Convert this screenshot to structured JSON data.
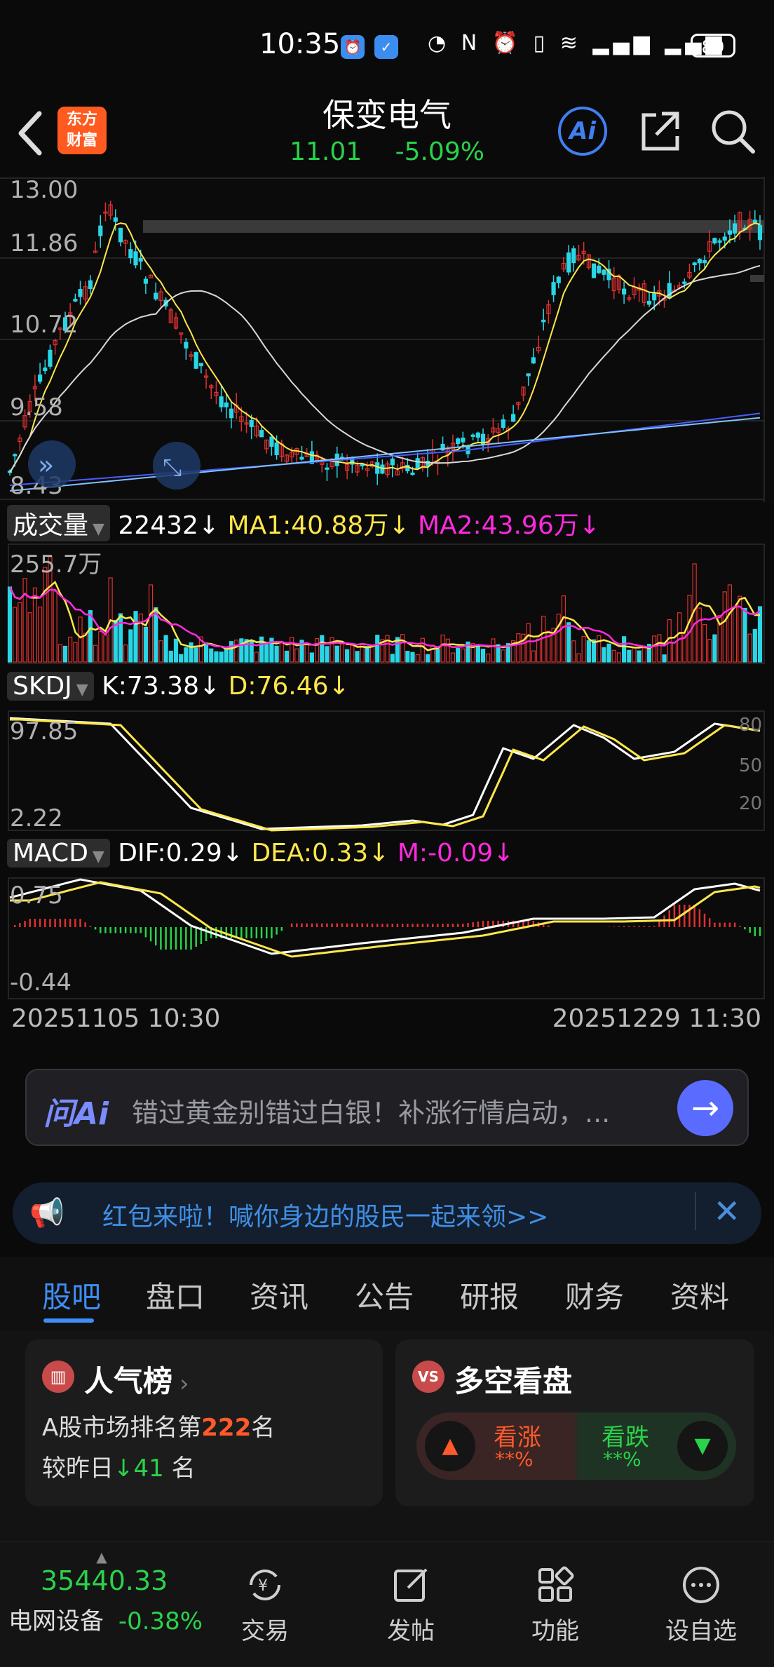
{
  "status_bar": {
    "time": "10:35",
    "battery": "89",
    "icons": [
      "app-icon-1",
      "app-icon-2",
      "speed-icon",
      "nfc-icon",
      "alarm-icon",
      "vibrate-icon",
      "wifi-icon",
      "4g-signal-icon",
      "4g-signal-icon"
    ]
  },
  "header": {
    "back_icon": "chevron-left-icon",
    "logo_text": "东方财富",
    "stock_name": "保变电气",
    "price": "11.01",
    "change_pct": "-5.09%",
    "ai_label": "Ai",
    "share_icon": "share-icon",
    "search_icon": "search-icon"
  },
  "price_chart": {
    "y_labels": [
      "13.00",
      "11.86",
      "10.72",
      "9.58",
      "8.43"
    ]
  },
  "volume_indicator": {
    "selector": "成交量",
    "value": "22432↓",
    "ma1": "MA1:40.88万↓",
    "ma2": "MA2:43.96万↓",
    "y_max": "255.7万"
  },
  "skdj_indicator": {
    "selector": "SKDJ",
    "k": "K:73.38↓",
    "d": "D:76.46↓",
    "y_max": "97.85",
    "y_min": "2.22",
    "ref_levels": [
      "80",
      "50",
      "20"
    ]
  },
  "macd_indicator": {
    "selector": "MACD",
    "dif": "DIF:0.29↓",
    "dea": "DEA:0.33↓",
    "m": "M:-0.09↓",
    "y_max": "0.75",
    "y_min": "-0.44"
  },
  "date_range": {
    "start": "20251105 10:30",
    "end": "20251229 11:30"
  },
  "ask_ai": {
    "logo": "问Ai",
    "text": "错过黄金别错过白银！补涨行情启动，...",
    "send_icon": "arrow-right-icon"
  },
  "banner": {
    "icon": "megaphone-icon",
    "text": "红包来啦！喊你身边的股民一起来领>>",
    "close_icon": "close-icon"
  },
  "tabs": [
    "股吧",
    "盘口",
    "资讯",
    "公告",
    "研报",
    "财务",
    "资料"
  ],
  "active_tab": 0,
  "popularity_card": {
    "title": "人气榜",
    "rank_prefix": "A股市场排名第",
    "rank": "222",
    "rank_suffix": "名",
    "change_prefix": "较昨日",
    "change": "41",
    "change_suffix": "名"
  },
  "sentiment_card": {
    "icon_text": "VS",
    "title": "多空看盘",
    "bull_label": "看涨",
    "bull_value": "**%",
    "bear_label": "看跌",
    "bear_value": "**%"
  },
  "bottom_nav": {
    "index_value": "35440.33",
    "index_name": "电网设备",
    "index_change": "-0.38%",
    "items": [
      {
        "label": "交易",
        "icon": "yuan-refresh-icon"
      },
      {
        "label": "发帖",
        "icon": "edit-icon"
      },
      {
        "label": "功能",
        "icon": "grid-icon"
      },
      {
        "label": "设自选",
        "icon": "more-icon"
      }
    ]
  },
  "colors": {
    "up": "#e03030",
    "down": "#2ad24a",
    "accent": "#3d8ef5",
    "ma_yellow": "#ffe74a",
    "ma_magenta": "#ff2adf"
  }
}
